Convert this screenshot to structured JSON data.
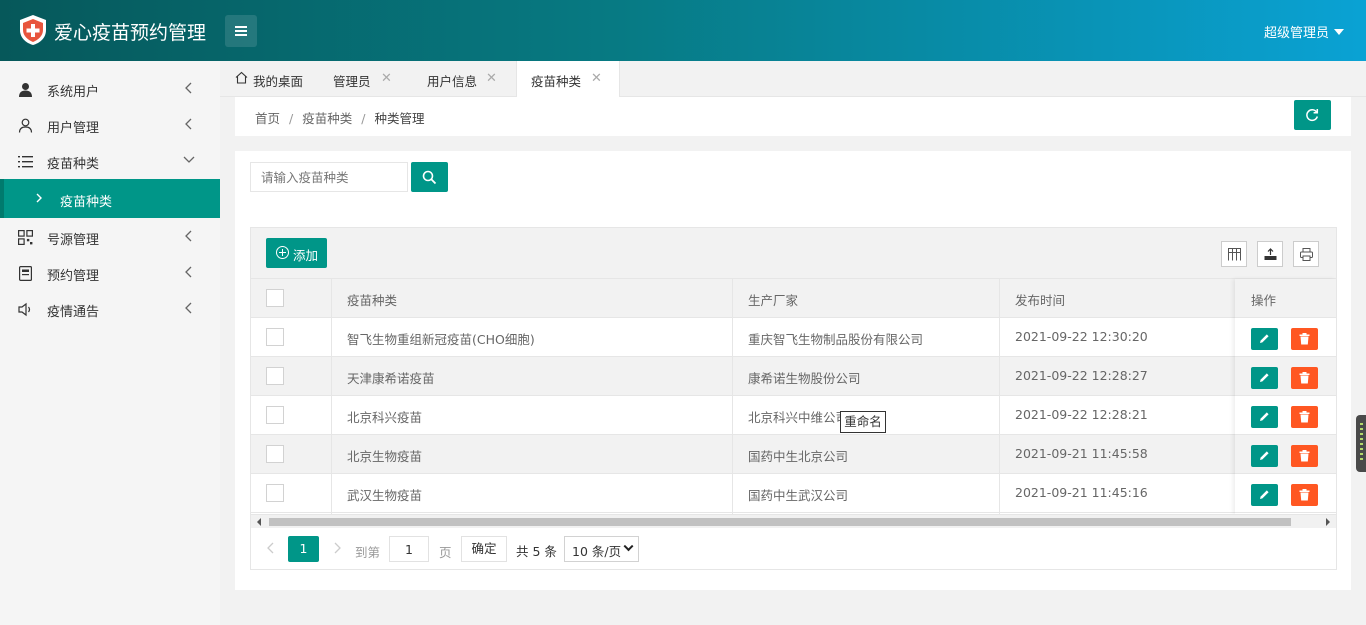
{
  "header": {
    "title": "爱心疫苗预约管理",
    "user_name": "超级管理员",
    "brand_color": "#009688"
  },
  "sidebar": {
    "items": [
      {
        "label": "系统用户",
        "icon": "user-solid-icon"
      },
      {
        "label": "用户管理",
        "icon": "user-outline-icon"
      },
      {
        "label": "疫苗种类",
        "icon": "list-icon"
      },
      {
        "label": "号源管理",
        "icon": "grid-icon"
      },
      {
        "label": "预约管理",
        "icon": "form-icon"
      },
      {
        "label": "疫情通告",
        "icon": "speaker-icon"
      }
    ],
    "active_sub": {
      "label": "疫苗种类"
    }
  },
  "tabs": [
    {
      "label": "我的桌面"
    },
    {
      "label": "管理员"
    },
    {
      "label": "用户信息"
    },
    {
      "label": "疫苗种类",
      "active": true
    }
  ],
  "breadcrumb": {
    "home": "首页",
    "parent": "疫苗种类",
    "current": "种类管理",
    "sep": "/"
  },
  "search": {
    "placeholder": "请输入疫苗种类",
    "value": ""
  },
  "toolbar": {
    "add_label": "添加"
  },
  "table": {
    "columns": [
      "疫苗种类",
      "生产厂家",
      "发布时间",
      "操作"
    ],
    "rows": [
      {
        "name": "智飞生物重组新冠疫苗(CHO细胞)",
        "maker": "重庆智飞生物制品股份有限公司",
        "time": "2021-09-22 12:30:20"
      },
      {
        "name": "天津康希诺疫苗",
        "maker": "康希诺生物股份公司",
        "time": "2021-09-22 12:28:27"
      },
      {
        "name": "北京科兴疫苗",
        "maker": "北京科兴中维公司",
        "time": "2021-09-22 12:28:21"
      },
      {
        "name": "北京生物疫苗",
        "maker": "国药中生北京公司",
        "time": "2021-09-21 11:45:58"
      },
      {
        "name": "武汉生物疫苗",
        "maker": "国药中生武汉公司",
        "time": "2021-09-21 11:45:16"
      }
    ]
  },
  "pager": {
    "current": "1",
    "goto_label": "到第",
    "page_input": "1",
    "page_unit": "页",
    "confirm": "确定",
    "total": "共 5 条",
    "page_size": "10 条/页"
  },
  "tooltip": "重命名"
}
